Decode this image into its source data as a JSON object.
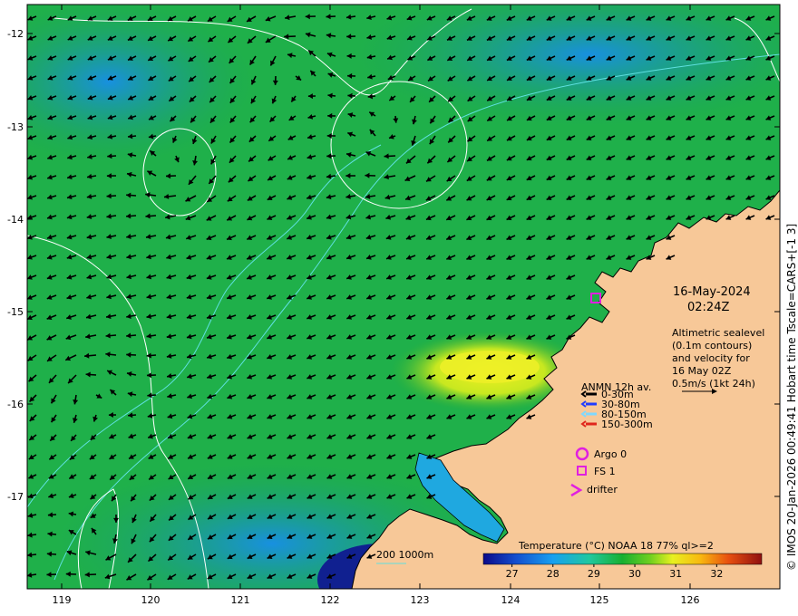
{
  "map": {
    "axes": {
      "x_ticks": [
        "119",
        "120",
        "121",
        "122",
        "123",
        "124",
        "125",
        "126"
      ],
      "y_ticks": [
        "-12",
        "-13",
        "-14",
        "-15",
        "-16",
        "-17"
      ],
      "lon_range": [
        118.6,
        127.0
      ],
      "lat_range": [
        -18.0,
        -11.7
      ]
    },
    "datetime": {
      "date": "16-May-2024",
      "time": "02:24Z"
    },
    "description": {
      "lines": [
        "Altimetric sealevel",
        "(0.1m contours)",
        "and velocity for",
        "16 May 02Z",
        "0.5m/s (1kt 24h)"
      ]
    },
    "legend_anmn": {
      "title": "ANMN 12h av.",
      "entries": [
        {
          "label": "0-30m",
          "color": "#000000"
        },
        {
          "label": "30-80m",
          "color": "#1f3cff"
        },
        {
          "label": "80-150m",
          "color": "#7fd8ff"
        },
        {
          "label": "150-300m",
          "color": "#e0261c"
        }
      ]
    },
    "legend_symbols": [
      {
        "label": "Argo 0",
        "icon": "circle-icon",
        "color": "#e020e0"
      },
      {
        "label": "FS 1",
        "icon": "square-icon",
        "color": "#e020e0"
      },
      {
        "label": "drifter",
        "icon": "chevron-icon",
        "color": "#e020e0"
      }
    ],
    "bathymetry_legend": "200  1000m",
    "colorbar": {
      "title": "Temperature (°C) NOAA 18 77% ql>=2",
      "ticks": [
        "27",
        "28",
        "29",
        "30",
        "31",
        "32"
      ],
      "min": 26.3,
      "max": 33.1
    },
    "side_caption": "© IMOS 20-Jan-2026 00:49:41 Hobart time Tscale=CARS+[-1 3]",
    "colors": {
      "land": "#f7c898",
      "coast": "#000000",
      "contour": "#ffffff",
      "bathy": "#5fe0e0",
      "marker": "#e020e0"
    },
    "markers": [
      {
        "icon": "square-icon",
        "lon": 124.95,
        "lat": -14.87
      }
    ]
  }
}
